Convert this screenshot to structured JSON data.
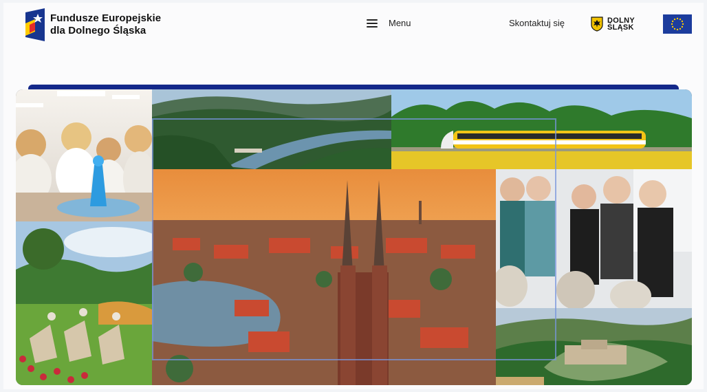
{
  "header": {
    "logo_line1": "Fundusze Europejskie",
    "logo_line2": "dla Dolnego Śląska",
    "menu_label": "Menu",
    "contact_label": "Skontaktuj się",
    "region_logo_line1": "DOLNY",
    "region_logo_line2": "ŚLĄSK"
  },
  "colors": {
    "brand_blue": "#13288a",
    "eu_blue": "#1c3c9d",
    "eu_star": "#ffcc00",
    "background": "#f2f4f7"
  },
  "hero": {
    "tiles": [
      "children-science-experiment-photo",
      "mountain-lake-valley-photo",
      "yellow-train-photo",
      "countryside-deckchairs-photo",
      "wroclaw-cathedral-sunset-photo",
      "women-pottery-workshop-photo",
      "hilltop-fortress-photo"
    ]
  }
}
